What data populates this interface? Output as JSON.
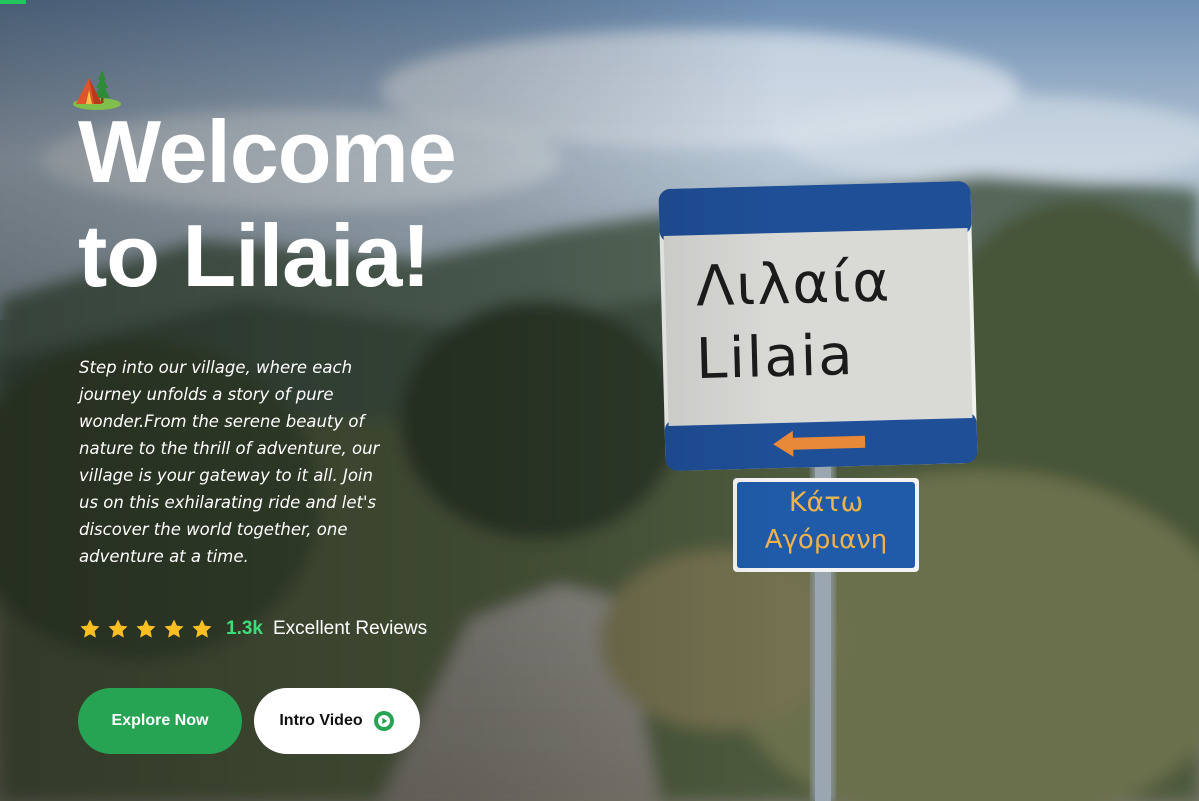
{
  "hero": {
    "title_line1": "Welcome",
    "title_line2": "to Lilaia!",
    "description": "Step into our village, where each journey unfolds a story of pure wonder.From the serene beauty of nature to the thrill of adventure, our village is your gateway to it all. Join us on this exhilarating ride and let's discover the world together, one adventure at a time."
  },
  "sign": {
    "line1": "Λιλαία",
    "line2": "Lilaia",
    "sub_line1": "Κάτω",
    "sub_line2": "Αγόριανη"
  },
  "reviews": {
    "rating": 5,
    "count": "1.3k",
    "label": "Excellent Reviews"
  },
  "buttons": {
    "explore_label": "Explore Now",
    "video_label": "Intro Video"
  },
  "icons": {
    "logo": "tent-icon",
    "star": "star-icon",
    "play": "play-icon"
  },
  "colors": {
    "accent": "#27a354",
    "review_count": "#3fdc7a",
    "star": "#fbbf24",
    "sign_blue": "#1f4f97",
    "sign_arrow": "#e8893a"
  }
}
